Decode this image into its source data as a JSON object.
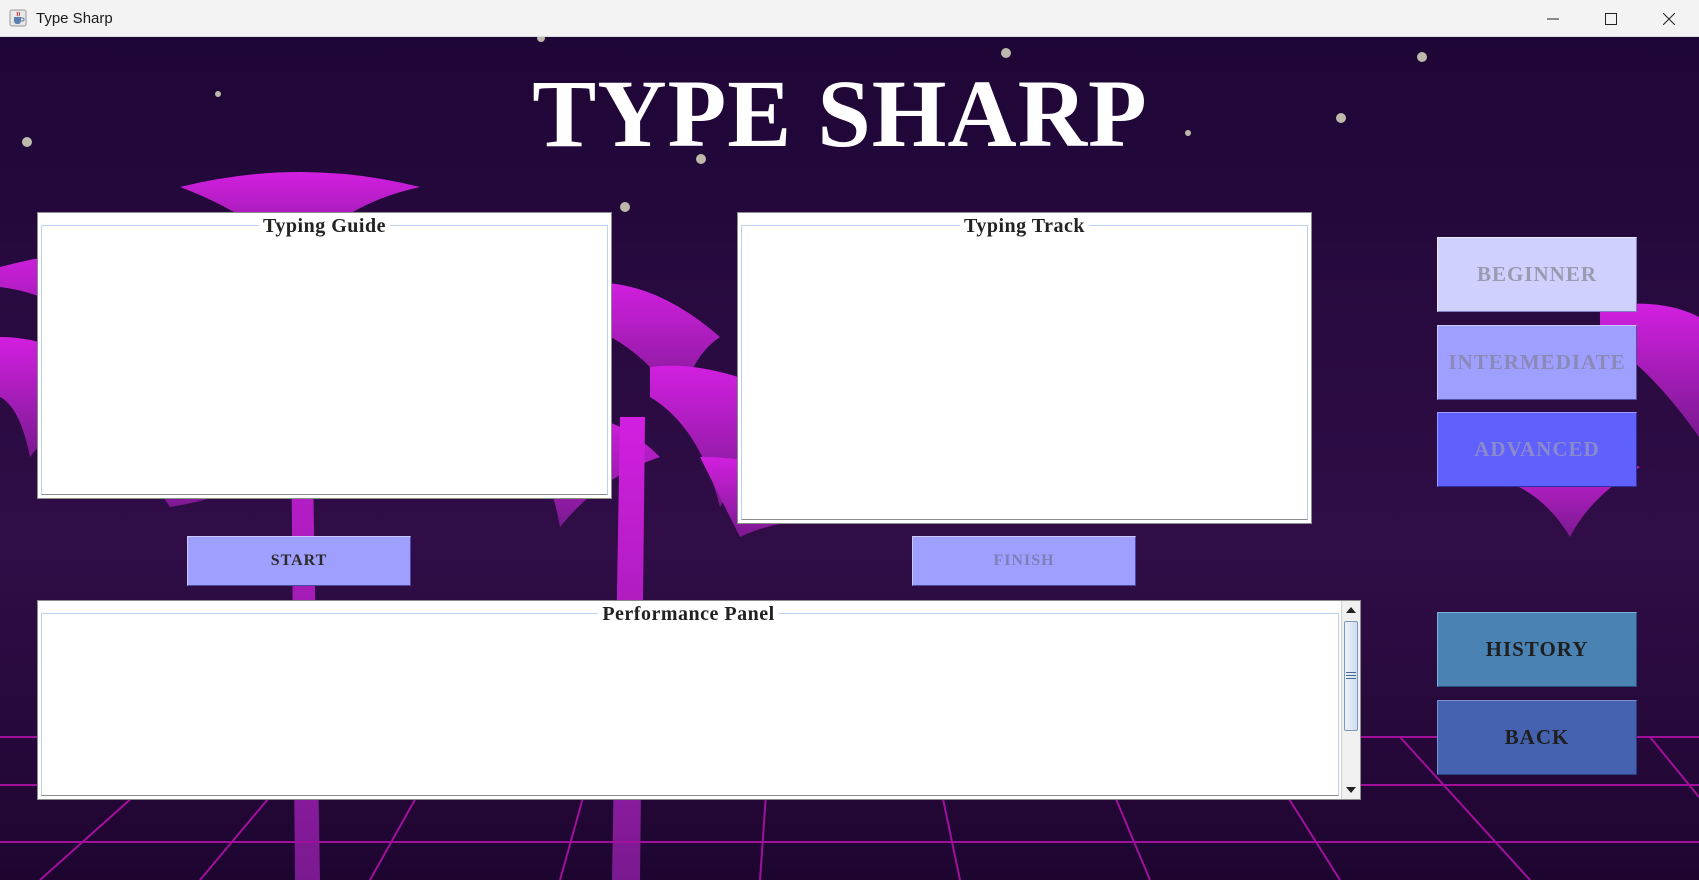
{
  "window": {
    "title": "Type Sharp"
  },
  "app": {
    "title": "TYPE SHARP"
  },
  "panels": {
    "typing_guide": {
      "title": "Typing Guide",
      "content": ""
    },
    "typing_track": {
      "title": "Typing Track",
      "content": ""
    },
    "performance": {
      "title": "Performance Panel",
      "content": ""
    }
  },
  "buttons": {
    "start": "START",
    "finish": "FINISH",
    "beginner": "BEGINNER",
    "intermediate": "INTERMEDIATE",
    "advanced": "ADVANCED",
    "history": "HISTORY",
    "back": "BACK"
  },
  "colors": {
    "background": "#2a0b3d",
    "palm": "#c020d0",
    "grid": "#a0109a",
    "beginner_bg": "#d0d0ff",
    "intermediate_bg": "#9f9fff",
    "advanced_bg": "#6060ff",
    "action_bg": "#9f9fff",
    "history_bg": "#4a82b4",
    "back_bg": "#4462b0"
  },
  "icons": {
    "app": "java-cup-icon",
    "minimize": "minimize-icon",
    "maximize": "maximize-icon",
    "close": "close-icon"
  }
}
